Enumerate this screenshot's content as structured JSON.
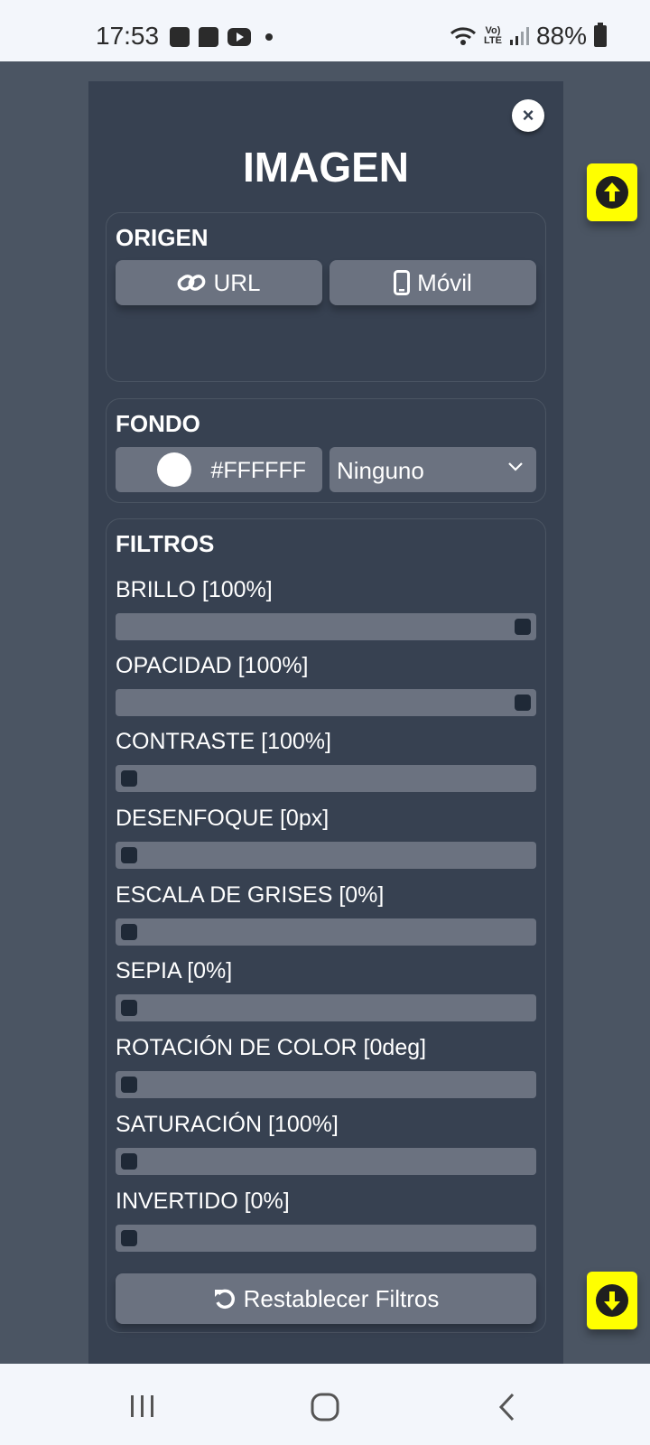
{
  "status_bar": {
    "time": "17:53",
    "battery": "88%",
    "network": "LTE"
  },
  "dialog": {
    "title": "IMAGEN",
    "close_icon": "×",
    "origen": {
      "title": "ORIGEN",
      "url_label": "URL",
      "movil_label": "Móvil"
    },
    "fondo": {
      "title": "FONDO",
      "color_value": "#FFFFFF",
      "select_value": "Ninguno"
    },
    "filtros": {
      "title": "FILTROS",
      "items": [
        {
          "label": "BRILLO [100%]",
          "level": 1.0
        },
        {
          "label": "OPACIDAD [100%]",
          "level": 1.0
        },
        {
          "label": "CONTRASTE [100%]",
          "level": 0.0
        },
        {
          "label": "DESENFOQUE [0px]",
          "level": 0.0
        },
        {
          "label": "ESCALA DE GRISES [0%]",
          "level": 0.0
        },
        {
          "label": "SEPIA [0%]",
          "level": 0.0
        },
        {
          "label": "ROTACIÓN DE COLOR [0deg]",
          "level": 0.0
        },
        {
          "label": "SATURACIÓN [100%]",
          "level": 0.0
        },
        {
          "label": "INVERTIDO [0%]",
          "level": 0.0
        }
      ],
      "reset_label": "Restablecer Filtros"
    }
  },
  "colors": {
    "panel": "#374151",
    "background": "#4b5563",
    "button": "#6b7280",
    "float_button": "#ffff00"
  }
}
